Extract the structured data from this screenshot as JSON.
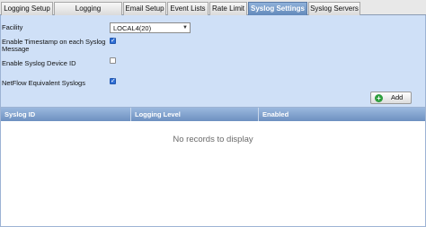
{
  "tabs": [
    {
      "label": "Logging Setup",
      "active": false
    },
    {
      "label": "Logging Destinations",
      "active": false
    },
    {
      "label": "Email Setup",
      "active": false
    },
    {
      "label": "Event Lists",
      "active": false
    },
    {
      "label": "Rate Limit",
      "active": false
    },
    {
      "label": "Syslog Settings",
      "active": true
    },
    {
      "label": "Syslog Servers",
      "active": false
    }
  ],
  "settings": {
    "facility_label": "Facility",
    "facility_value": "LOCAL4(20)",
    "timestamp_label_line1": "Enable Timestamp on each Syslog",
    "timestamp_label_line2": "Message",
    "timestamp_checked": true,
    "device_id_label": "Enable Syslog Device ID",
    "device_id_checked": false,
    "netflow_label": "NetFlow Equivalent Syslogs",
    "netflow_checked": true
  },
  "add_button": {
    "label": "Add",
    "icon": "plus-icon"
  },
  "table": {
    "columns": [
      "Syslog ID",
      "Logging Level",
      "Enabled"
    ],
    "empty_text": "No records to display"
  },
  "colors": {
    "panel": "#cfe0f7",
    "active_tab": "#6f94c4",
    "header": "#7e9fcc"
  }
}
